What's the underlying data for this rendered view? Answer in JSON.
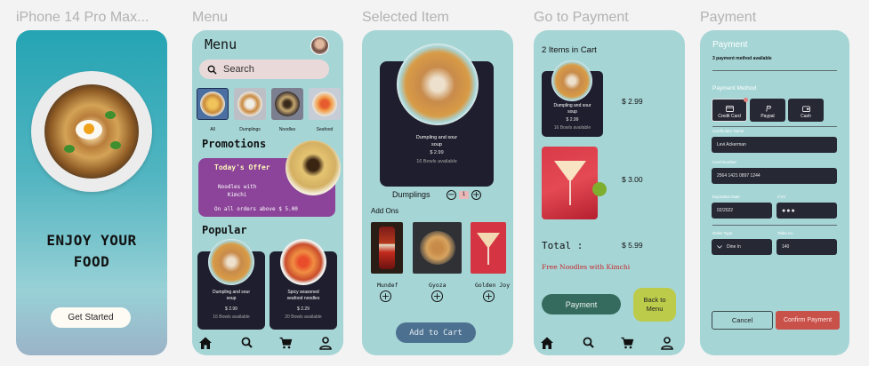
{
  "frames": {
    "splash": "iPhone 14 Pro Max...",
    "menu": "Menu",
    "selected": "Selected Item",
    "go_payment": "Go to Payment",
    "payment": "Payment"
  },
  "splash": {
    "title_line1": "ENJOY YOUR",
    "title_line2": "FOOD",
    "cta": "Get Started"
  },
  "menu": {
    "title": "Menu",
    "search_placeholder": "Search",
    "categories": [
      {
        "label": "All"
      },
      {
        "label": "Dumplings"
      },
      {
        "label": "Noodles"
      },
      {
        "label": "Seafood"
      }
    ],
    "promotions_heading": "Promotions",
    "promo": {
      "title": "Today's Offer",
      "item_line1": "Noodles with",
      "item_line2": "Kimchi",
      "terms": "On all orders above $ 5.00"
    },
    "popular_heading": "Popular",
    "popular": [
      {
        "name_line1": "Dumpling and sour",
        "name_line2": "soup",
        "price": "$ 2.99",
        "availability": "16 Bowls available"
      },
      {
        "name_line1": "Spicy seasoned",
        "name_line2": "seafood noodles",
        "price": "$ 2.29",
        "availability": "20 Bowls available"
      }
    ]
  },
  "selected": {
    "item": {
      "name_line1": "Dumpling and sour",
      "name_line2": "soup",
      "price": "$ 2.99",
      "availability": "16 Bowls available"
    },
    "qty_label": "Dumplings",
    "qty_minus": "−",
    "qty_value": "1",
    "qty_plus": "+",
    "addons_heading": "Add Ons",
    "addons": [
      {
        "name": "Mundef",
        "plus": "+"
      },
      {
        "name": "Gyoza",
        "plus": "+"
      },
      {
        "name": "Golden Joy",
        "plus": "+"
      }
    ],
    "add_to_cart": "Add to Cart"
  },
  "cart": {
    "title": "2 Items in Cart",
    "item1": {
      "name_line1": "Dumpling and sour",
      "name_line2": "soup",
      "price_small": "$ 2.99",
      "availability": "16 Bowls available",
      "price": "$ 2.99"
    },
    "item2": {
      "price": "$ 3.00"
    },
    "total_label": "Total :",
    "total_value": "$ 5.99",
    "promo_note": "Free Noodles with Kimchi",
    "payment_button": "Payment",
    "back_line1": "Back to",
    "back_line2": "Menu"
  },
  "payment": {
    "title": "Payment",
    "subtitle": "3 payment method available",
    "method_heading": "Payment Method",
    "methods": [
      {
        "label": "Credit Card"
      },
      {
        "label": "Paypal"
      },
      {
        "label": "Cash"
      }
    ],
    "cardholder_label": "Cardholder Name",
    "cardholder_value": "Levi Ackerman",
    "card_number_label": "Card Number",
    "card_number_value": "2564 1421 0897 1244",
    "expiration_label": "Expiration Date",
    "expiration_value": "02/2022",
    "cvv_label": "CVV",
    "cvv_value": "●●●",
    "order_type_label": "Order Type",
    "order_type_value": "Dine In",
    "table_label": "Table no.",
    "table_value": "140",
    "cancel": "Cancel",
    "confirm": "Confirm Payment"
  },
  "colors": {
    "screen_bg": "#a6d5d6",
    "dark_card": "#1f1e2e",
    "promo_purple": "#8b4499",
    "payment_green": "#356b5e",
    "back_lime": "#bccb4a",
    "confirm_red": "#c8514a",
    "add_cart_blue": "#4c7190"
  }
}
